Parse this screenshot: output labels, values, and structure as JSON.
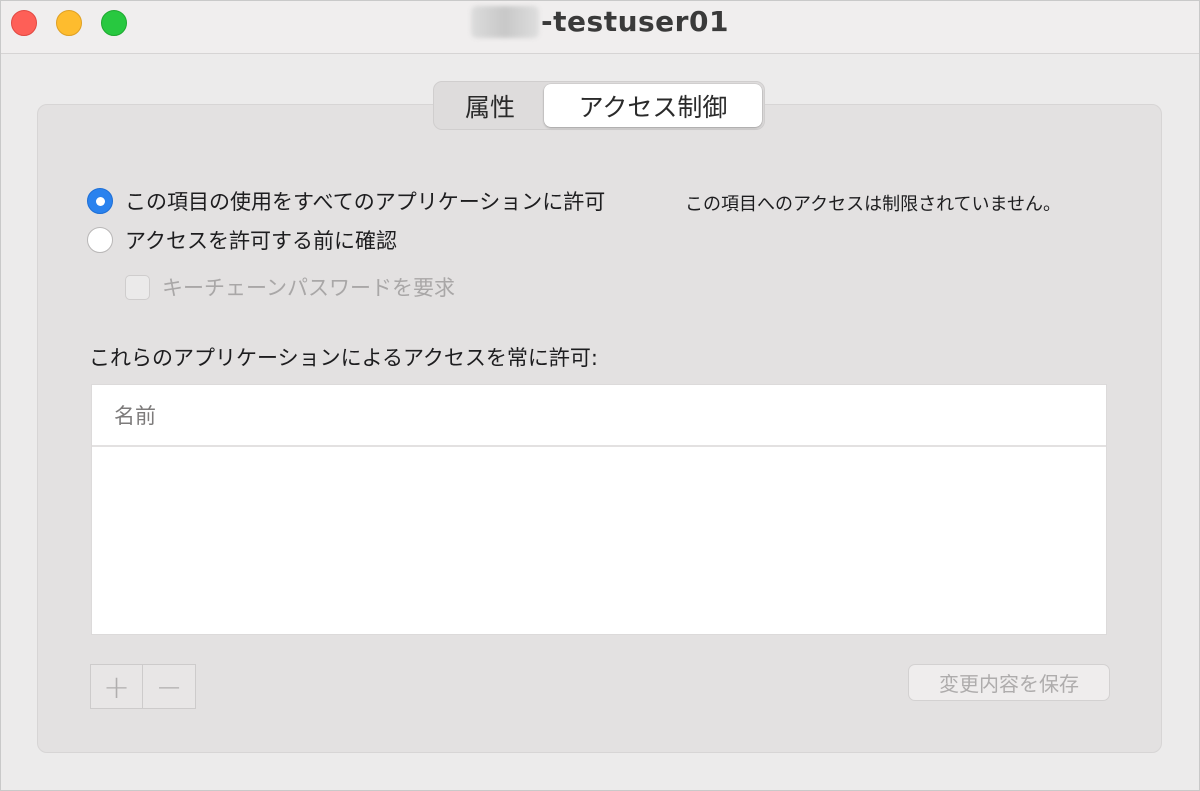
{
  "window": {
    "title_suffix": "-testuser01"
  },
  "tabs": [
    {
      "label": "属性",
      "selected": false
    },
    {
      "label": "アクセス制御",
      "selected": true
    }
  ],
  "access": {
    "option_allow_all": "この項目の使用をすべてのアプリケーションに許可",
    "option_allow_all_selected": true,
    "option_confirm": "アクセスを許可する前に確認",
    "option_confirm_selected": false,
    "keychain_password_label": "キーチェーンパスワードを要求",
    "keychain_password_checked": false,
    "note": "この項目へのアクセスは制限されていません。"
  },
  "app_list": {
    "label": "これらのアプリケーションによるアクセスを常に許可:",
    "column_name": "名前",
    "rows": []
  },
  "buttons": {
    "add": "+",
    "remove": "−",
    "save": "変更内容を保存"
  },
  "colors": {
    "accent": "#2a82ee",
    "close": "#fe5f57",
    "minimize": "#febc2e",
    "zoom": "#28c840"
  }
}
